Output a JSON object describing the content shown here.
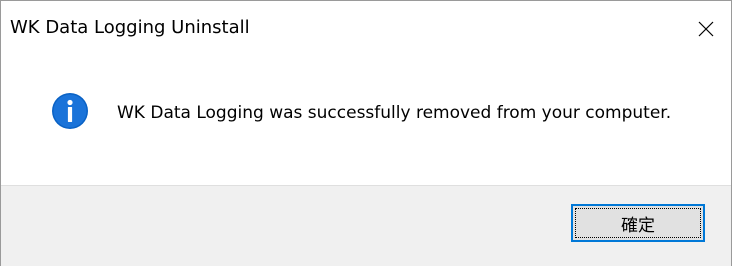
{
  "window": {
    "title": "WK Data Logging Uninstall",
    "close_icon": "close-icon"
  },
  "content": {
    "icon": "info-icon",
    "message": "WK Data Logging was successfully removed from your computer."
  },
  "footer": {
    "ok_label": "確定"
  },
  "colors": {
    "accent": "#0078d7",
    "footer_bg": "#f0f0f0",
    "button_bg": "#e1e1e1"
  }
}
